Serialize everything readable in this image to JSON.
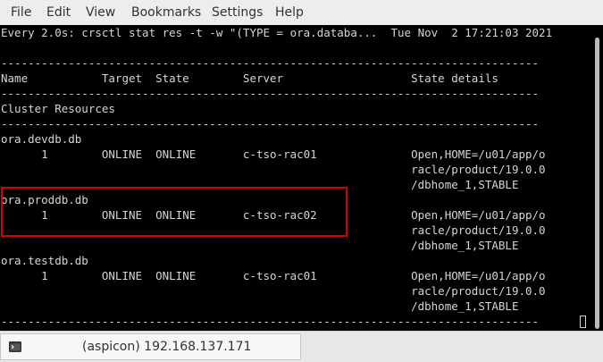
{
  "menu": [
    "File",
    "Edit",
    "View",
    "Bookmarks",
    "Settings",
    "Help"
  ],
  "terminal": {
    "lines": [
      "Every 2.0s: crsctl stat res -t -w \"(TYPE = ora.databa...  Tue Nov  2 17:21:03 2021",
      "",
      "--------------------------------------------------------------------------------",
      "Name           Target  State        Server                   State details",
      "--------------------------------------------------------------------------------",
      "Cluster Resources",
      "--------------------------------------------------------------------------------",
      "ora.devdb.db",
      "      1        ONLINE  ONLINE       c-tso-rac01              Open,HOME=/u01/app/o",
      "                                                             racle/product/19.0.0",
      "                                                             /dbhome_1,STABLE",
      "ora.proddb.db",
      "      1        ONLINE  ONLINE       c-tso-rac02              Open,HOME=/u01/app/o",
      "                                                             racle/product/19.0.0",
      "                                                             /dbhome_1,STABLE",
      "ora.testdb.db",
      "      1        ONLINE  ONLINE       c-tso-rac01              Open,HOME=/u01/app/o",
      "                                                             racle/product/19.0.0",
      "                                                             /dbhome_1,STABLE",
      "--------------------------------------------------------------------------------"
    ],
    "highlight_color": "#d40000"
  },
  "taskbar": {
    "window_label": "(aspicon) 192.168.137.171",
    "icon": "terminal-icon"
  }
}
